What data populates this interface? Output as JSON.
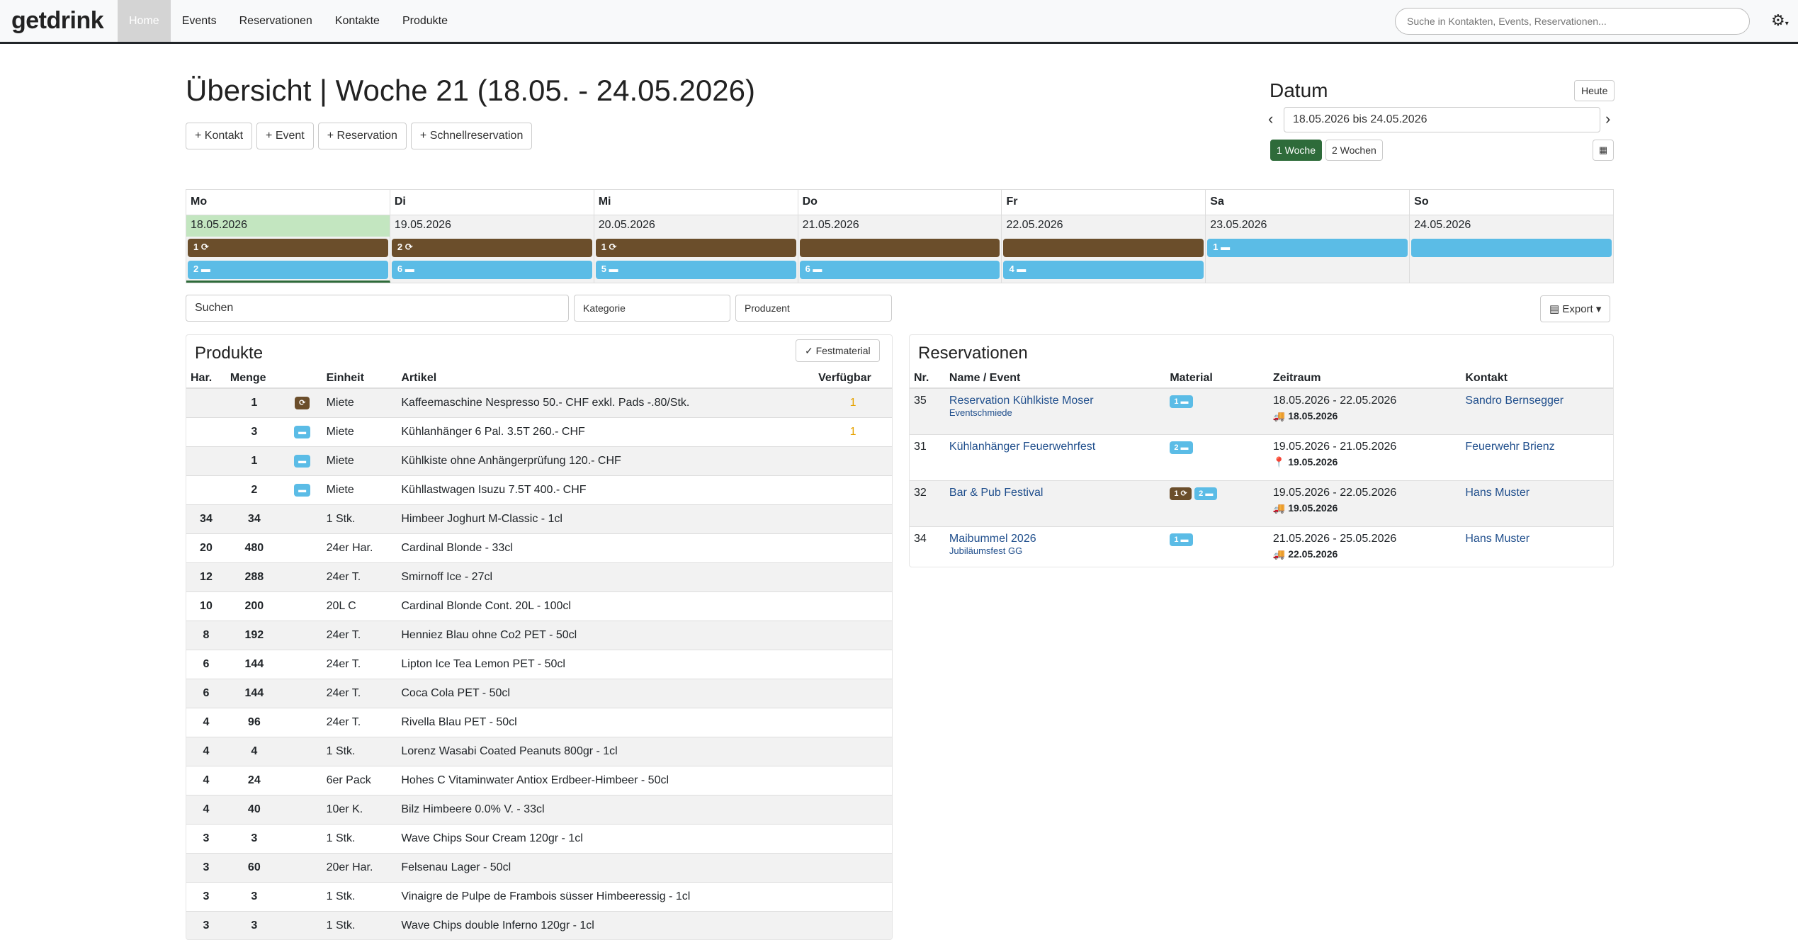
{
  "nav": {
    "brand": "getdrink",
    "items": [
      "Home",
      "Events",
      "Reservationen",
      "Kontakte",
      "Produkte"
    ],
    "search_placeholder": "Suche in Kontakten, Events, Reservationen..."
  },
  "header": {
    "title": "Übersicht | Woche 21 (18.05. - 24.05.2026)",
    "quick_buttons": [
      "+ Kontakt",
      "+ Event",
      "+ Reservation",
      "+ Schnellreservation"
    ]
  },
  "datum": {
    "title": "Datum",
    "today_label": "Heute",
    "range": "18.05.2026 bis 24.05.2026",
    "one_week": "1 Woche",
    "two_weeks": "2 Wochen"
  },
  "week": [
    {
      "name": "Mo",
      "date": "18.05.2026",
      "brown": "1 ⟳",
      "blue": "2 ▬"
    },
    {
      "name": "Di",
      "date": "19.05.2026",
      "brown": "2 ⟳",
      "blue": "6 ▬"
    },
    {
      "name": "Mi",
      "date": "20.05.2026",
      "brown": "1 ⟳",
      "blue": "5 ▬"
    },
    {
      "name": "Do",
      "date": "21.05.2026",
      "brown": "",
      "blue": "6 ▬"
    },
    {
      "name": "Fr",
      "date": "22.05.2026",
      "brown": "",
      "blue": "4 ▬"
    },
    {
      "name": "Sa",
      "date": "23.05.2026",
      "blue_top": "1 ▬"
    },
    {
      "name": "So",
      "date": "24.05.2026",
      "blue_top": ""
    }
  ],
  "filters": {
    "search": "Suchen",
    "category": "Kategorie",
    "producer": "Produzent",
    "export": "Export"
  },
  "produkte": {
    "title": "Produkte",
    "festmaterial": "✓ Festmaterial",
    "headers": [
      "Har.",
      "Menge",
      "",
      "Einheit",
      "Artikel",
      "Verfügbar"
    ],
    "rows": [
      {
        "har": "",
        "menge": "1",
        "badge": "brown",
        "einheit": "Miete",
        "artikel": "Kaffeemaschine Nespresso 50.- CHF exkl. Pads -.80/Stk.",
        "verf": "1"
      },
      {
        "har": "",
        "menge": "3",
        "badge": "blue",
        "einheit": "Miete",
        "artikel": "Kühlanhänger 6 Pal. 3.5T 260.- CHF",
        "verf": "1"
      },
      {
        "har": "",
        "menge": "1",
        "badge": "blue",
        "einheit": "Miete",
        "artikel": "Kühlkiste ohne Anhängerprüfung 120.- CHF",
        "verf": ""
      },
      {
        "har": "",
        "menge": "2",
        "badge": "blue",
        "einheit": "Miete",
        "artikel": "Kühllastwagen Isuzu 7.5T 400.- CHF",
        "verf": ""
      },
      {
        "har": "34",
        "menge": "34",
        "badge": "",
        "einheit": "1 Stk.",
        "artikel": "Himbeer Joghurt M-Classic - 1cl",
        "verf": ""
      },
      {
        "har": "20",
        "menge": "480",
        "badge": "",
        "einheit": "24er Har.",
        "artikel": "Cardinal Blonde - 33cl",
        "verf": ""
      },
      {
        "har": "12",
        "menge": "288",
        "badge": "",
        "einheit": "24er T.",
        "artikel": "Smirnoff Ice - 27cl",
        "verf": ""
      },
      {
        "har": "10",
        "menge": "200",
        "badge": "",
        "einheit": "20L C",
        "artikel": "Cardinal Blonde Cont. 20L - 100cl",
        "verf": ""
      },
      {
        "har": "8",
        "menge": "192",
        "badge": "",
        "einheit": "24er T.",
        "artikel": "Henniez Blau ohne Co2 PET - 50cl",
        "verf": ""
      },
      {
        "har": "6",
        "menge": "144",
        "badge": "",
        "einheit": "24er T.",
        "artikel": "Lipton Ice Tea Lemon PET - 50cl",
        "verf": ""
      },
      {
        "har": "6",
        "menge": "144",
        "badge": "",
        "einheit": "24er T.",
        "artikel": "Coca Cola PET - 50cl",
        "verf": ""
      },
      {
        "har": "4",
        "menge": "96",
        "badge": "",
        "einheit": "24er T.",
        "artikel": "Rivella Blau PET - 50cl",
        "verf": ""
      },
      {
        "har": "4",
        "menge": "4",
        "badge": "",
        "einheit": "1 Stk.",
        "artikel": "Lorenz Wasabi Coated Peanuts 800gr - 1cl",
        "verf": ""
      },
      {
        "har": "4",
        "menge": "24",
        "badge": "",
        "einheit": "6er Pack",
        "artikel": "Hohes C Vitaminwater Antiox Erdbeer-Himbeer - 50cl",
        "verf": ""
      },
      {
        "har": "4",
        "menge": "40",
        "badge": "",
        "einheit": "10er K.",
        "artikel": "Bilz Himbeere 0.0% V. - 33cl",
        "verf": ""
      },
      {
        "har": "3",
        "menge": "3",
        "badge": "",
        "einheit": "1 Stk.",
        "artikel": "Wave Chips Sour Cream 120gr - 1cl",
        "verf": ""
      },
      {
        "har": "3",
        "menge": "60",
        "badge": "",
        "einheit": "20er Har.",
        "artikel": "Felsenau Lager - 50cl",
        "verf": ""
      },
      {
        "har": "3",
        "menge": "3",
        "badge": "",
        "einheit": "1 Stk.",
        "artikel": "Vinaigre de Pulpe de Frambois süsser Himbeeressig - 1cl",
        "verf": ""
      },
      {
        "har": "3",
        "menge": "3",
        "badge": "",
        "einheit": "1 Stk.",
        "artikel": "Wave Chips double Inferno 120gr - 1cl",
        "verf": ""
      }
    ]
  },
  "reservationen": {
    "title": "Reservationen",
    "headers": [
      "Nr.",
      "Name / Event",
      "Material",
      "Zeitraum",
      "Kontakt"
    ],
    "rows": [
      {
        "nr": "35",
        "name": "Reservation Kühlkiste Moser",
        "event": "Eventschmiede",
        "material": [
          {
            "type": "blue",
            "label": "1 ▬"
          }
        ],
        "zeitraum": "18.05.2026 - 22.05.2026",
        "sub_icon": "🚚",
        "sub": "18.05.2026",
        "kontakt": "Sandro Bernsegger"
      },
      {
        "nr": "31",
        "name": "Kühlanhänger Feuerwehrfest",
        "event": "",
        "material": [
          {
            "type": "blue",
            "label": "2 ▬"
          }
        ],
        "zeitraum": "19.05.2026 - 21.05.2026",
        "sub_icon": "📍",
        "sub": "19.05.2026",
        "kontakt": "Feuerwehr Brienz"
      },
      {
        "nr": "32",
        "name": "Bar & Pub Festival",
        "event": "",
        "material": [
          {
            "type": "brown",
            "label": "1 ⟳"
          },
          {
            "type": "blue",
            "label": "2 ▬"
          }
        ],
        "zeitraum": "19.05.2026 - 22.05.2026",
        "sub_icon": "🚚",
        "sub": "19.05.2026",
        "kontakt": "Hans Muster"
      },
      {
        "nr": "34",
        "name": "Maibummel 2026",
        "event": "Jubiläumsfest GG",
        "material": [
          {
            "type": "blue",
            "label": "1 ▬"
          }
        ],
        "zeitraum": "21.05.2026 - 25.05.2026",
        "sub_icon": "🚚",
        "sub": "22.05.2026",
        "kontakt": "Hans Muster"
      }
    ]
  }
}
